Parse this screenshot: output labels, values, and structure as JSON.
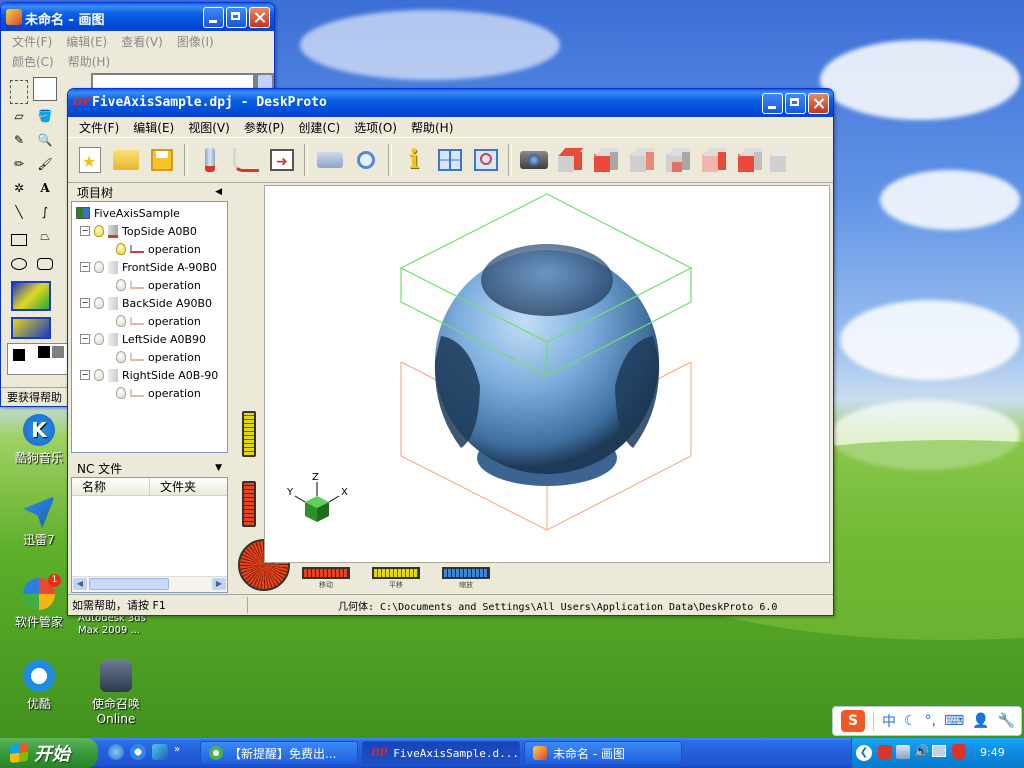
{
  "desktop": {
    "icons": [
      {
        "label_line1": "酷狗音乐",
        "label_line2": "",
        "icon": "kugou-icon"
      },
      {
        "label_line1": "迅雷7",
        "label_line2": "",
        "icon": "thunder-icon"
      },
      {
        "label_line1": "软件管家",
        "label_line2": "",
        "icon": "software-manager-icon",
        "badge": "1"
      },
      {
        "label_line1": "优酷",
        "label_line2": "",
        "icon": "youku-icon"
      },
      {
        "label_line1": "使命召唤",
        "label_line2": "Online",
        "icon": "cod-online-icon"
      }
    ],
    "partial_label": {
      "line1": "Autodesk 3ds",
      "line2": "Max 2009 ..."
    }
  },
  "paint": {
    "title": "未命名 - 画图",
    "menu1": [
      "文件(F)",
      "编辑(E)",
      "查看(V)",
      "图像(I)"
    ],
    "menu2": [
      "颜色(C)",
      "帮助(H)"
    ],
    "status": "要获得帮助"
  },
  "deskproto": {
    "title": "FiveAxisSample.dpj - DeskProto",
    "logo": "DP",
    "menu": [
      "文件(F)",
      "编辑(E)",
      "视图(V)",
      "参数(P)",
      "创建(C)",
      "选项(O)",
      "帮助(H)"
    ],
    "toolbar": [
      "new-file-icon",
      "open-folder-icon",
      "save-icon",
      "sep",
      "toolpath-icon",
      "calculate-icon",
      "save-nc-icon",
      "sep",
      "print-icon",
      "preview-icon",
      "sep",
      "info-icon",
      "view-layout-icon",
      "zoom-view-icon",
      "sep",
      "camera-icon",
      "cube-top-icon",
      "cube-front-icon",
      "cube-back-icon",
      "cube-left-icon",
      "cube-right-icon",
      "cube-iso-icon",
      "cube-bottom-icon"
    ],
    "project_tree": {
      "header": "项目树",
      "root": "FiveAxisSample",
      "nodes": [
        {
          "name": "TopSide A0B0",
          "op": "operation",
          "active": true
        },
        {
          "name": "FrontSide A-90B0",
          "op": "operation",
          "active": false
        },
        {
          "name": "BackSide A90B0",
          "op": "operation",
          "active": false
        },
        {
          "name": "LeftSide A0B90",
          "op": "operation",
          "active": false
        },
        {
          "name": "RightSide A0B-90",
          "op": "operation",
          "active": false
        }
      ]
    },
    "nc_files": {
      "header": "NC 文件",
      "columns": [
        "名称",
        "文件夹"
      ]
    },
    "axis_labels": {
      "x": "X",
      "y": "Y",
      "z": "Z"
    },
    "bottom_controls": [
      {
        "label": "移动",
        "color": "#d8361d"
      },
      {
        "label": "平移",
        "color": "#e3d91a"
      },
      {
        "label": "缩放",
        "color": "#3b87dd"
      }
    ],
    "status_left": "如需帮助，请按 F1",
    "status_right": "几何体: C:\\Documents and Settings\\All Users\\Application Data\\DeskProto 6.0"
  },
  "ime": {
    "logo": "S",
    "mode": "中"
  },
  "taskbar": {
    "start": "开始",
    "tasks": [
      {
        "label": "【新提醒】免费出...",
        "icon": "browser-icon"
      },
      {
        "label": "FiveAxisSample.d...",
        "icon": "deskproto-icon"
      },
      {
        "label": "未命名 - 画图",
        "icon": "paint-icon"
      }
    ],
    "clock": "9:49"
  }
}
